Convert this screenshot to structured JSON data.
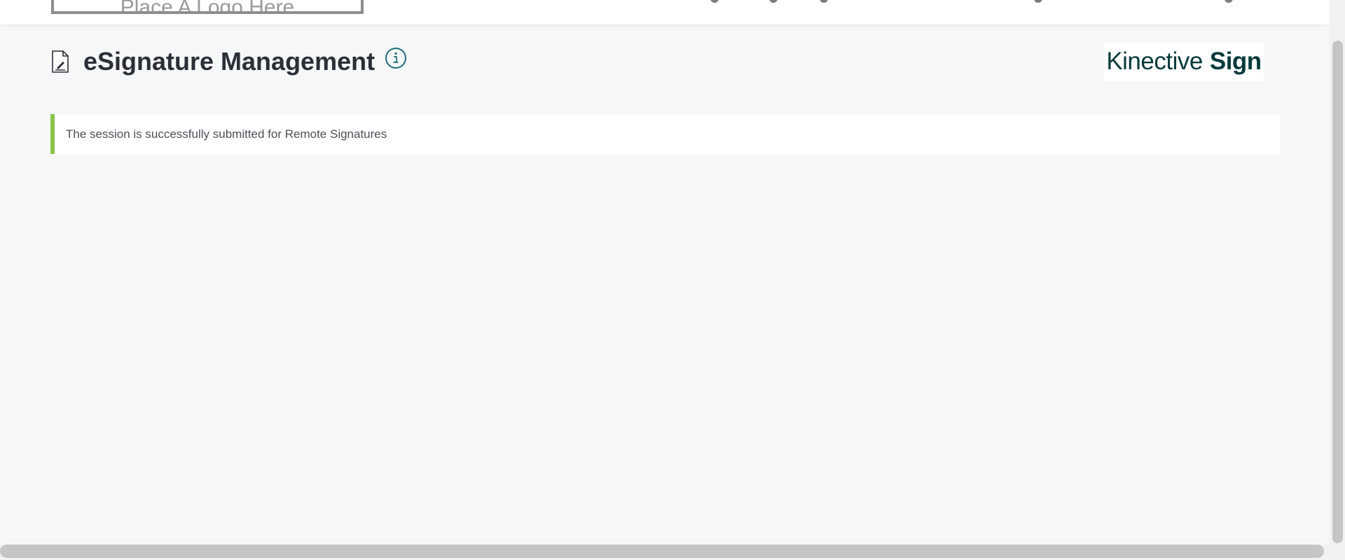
{
  "header": {
    "logo_placeholder": "Place A Logo Here"
  },
  "page": {
    "title": "eSignature Management",
    "info_icon": "info-circle-icon",
    "doc_icon": "document-sign-icon"
  },
  "brand": {
    "name_light": "Kinective",
    "name_bold": "Sign",
    "color": "#073a3c"
  },
  "alert": {
    "message": "The session is successfully submitted for Remote Signatures",
    "accent_color": "#8bc34a"
  }
}
